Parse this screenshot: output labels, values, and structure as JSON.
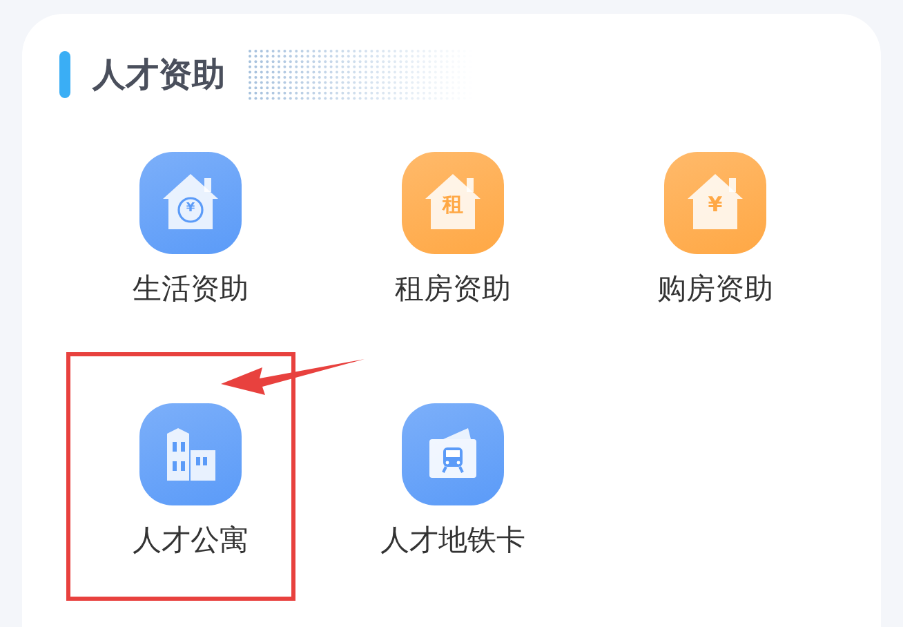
{
  "section": {
    "title": "人才资助"
  },
  "items": [
    {
      "label": "生活资助",
      "kind": "house-coin",
      "glyph": "¥",
      "color": "#5b9bf8",
      "highlighted": false
    },
    {
      "label": "租房资助",
      "kind": "house-text",
      "glyph": "租",
      "color": "#ffa845",
      "highlighted": false
    },
    {
      "label": "购房资助",
      "kind": "house-text",
      "glyph": "¥",
      "color": "#ffa845",
      "highlighted": false
    },
    {
      "label": "人才公寓",
      "kind": "buildings",
      "color": "#5b9bf8",
      "highlighted": true
    },
    {
      "label": "人才地铁卡",
      "kind": "metro-card",
      "color": "#5b9bf8",
      "highlighted": false
    }
  ]
}
